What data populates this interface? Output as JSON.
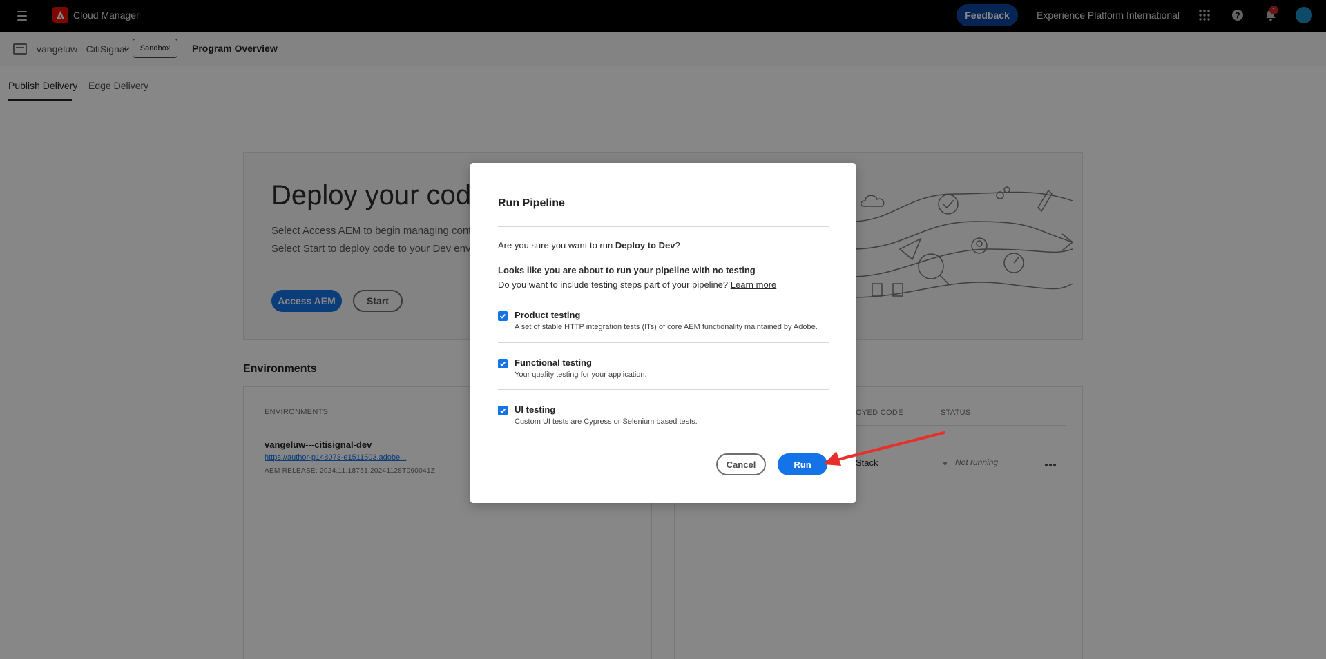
{
  "topbar": {
    "app_title": "Cloud Manager",
    "feedback_label": "Feedback",
    "org_name": "Experience Platform International",
    "notification_count": "1",
    "icons": [
      "menu-icon",
      "adobe-logo",
      "apps-grid-icon",
      "help-icon",
      "bell-icon",
      "avatar"
    ]
  },
  "program_bar": {
    "program_name": "vangeluw - CitiSignal",
    "sandbox_label": "Sandbox",
    "page_title": "Program Overview"
  },
  "tabs": [
    {
      "label": "Publish Delivery",
      "active": true
    },
    {
      "label": "Edge Delivery",
      "active": false
    }
  ],
  "hero": {
    "title": "Deploy your code t",
    "line1": "Select Access AEM to begin managing conten",
    "line2": "Select Start to deploy code to your Dev envir",
    "access_label": "Access AEM",
    "start_label": "Start"
  },
  "environments": {
    "heading": "Environments",
    "left_col_head": "ENVIRONMENTS",
    "env_name": "vangeluw---citisignal-dev",
    "env_link": "https://author-p148073-e1511503.adobe...",
    "env_release": "AEM RELEASE: 2024.11.18751.20241128T090041Z",
    "right_col_head_code": "OYED CODE",
    "right_col_head_status": "STATUS",
    "stack_text": "Stack",
    "status_text": "Not running"
  },
  "dialog": {
    "title": "Run Pipeline",
    "confirm_prefix": "Are you sure you want to run ",
    "pipeline_name": "Deploy to Dev",
    "confirm_suffix": "?",
    "warning_bold": "Looks like you are about to run your pipeline with no testing",
    "include_question": "Do you want to include testing steps part of your pipeline?",
    "learn_more": "Learn more",
    "tests": [
      {
        "label": "Product testing",
        "desc": "A set of stable HTTP integration tests (ITs) of core AEM functionality maintained by Adobe.",
        "checked": true
      },
      {
        "label": "Functional testing",
        "desc": "Your quality testing for your application.",
        "checked": true
      },
      {
        "label": "UI testing",
        "desc": "Custom UI tests are Cypress or Selenium based tests.",
        "checked": true
      }
    ],
    "cancel_label": "Cancel",
    "run_label": "Run"
  },
  "colors": {
    "accent": "#1473e6",
    "annotation_arrow": "#e8302b",
    "overlay": "rgba(0,0,0,0.47)"
  }
}
